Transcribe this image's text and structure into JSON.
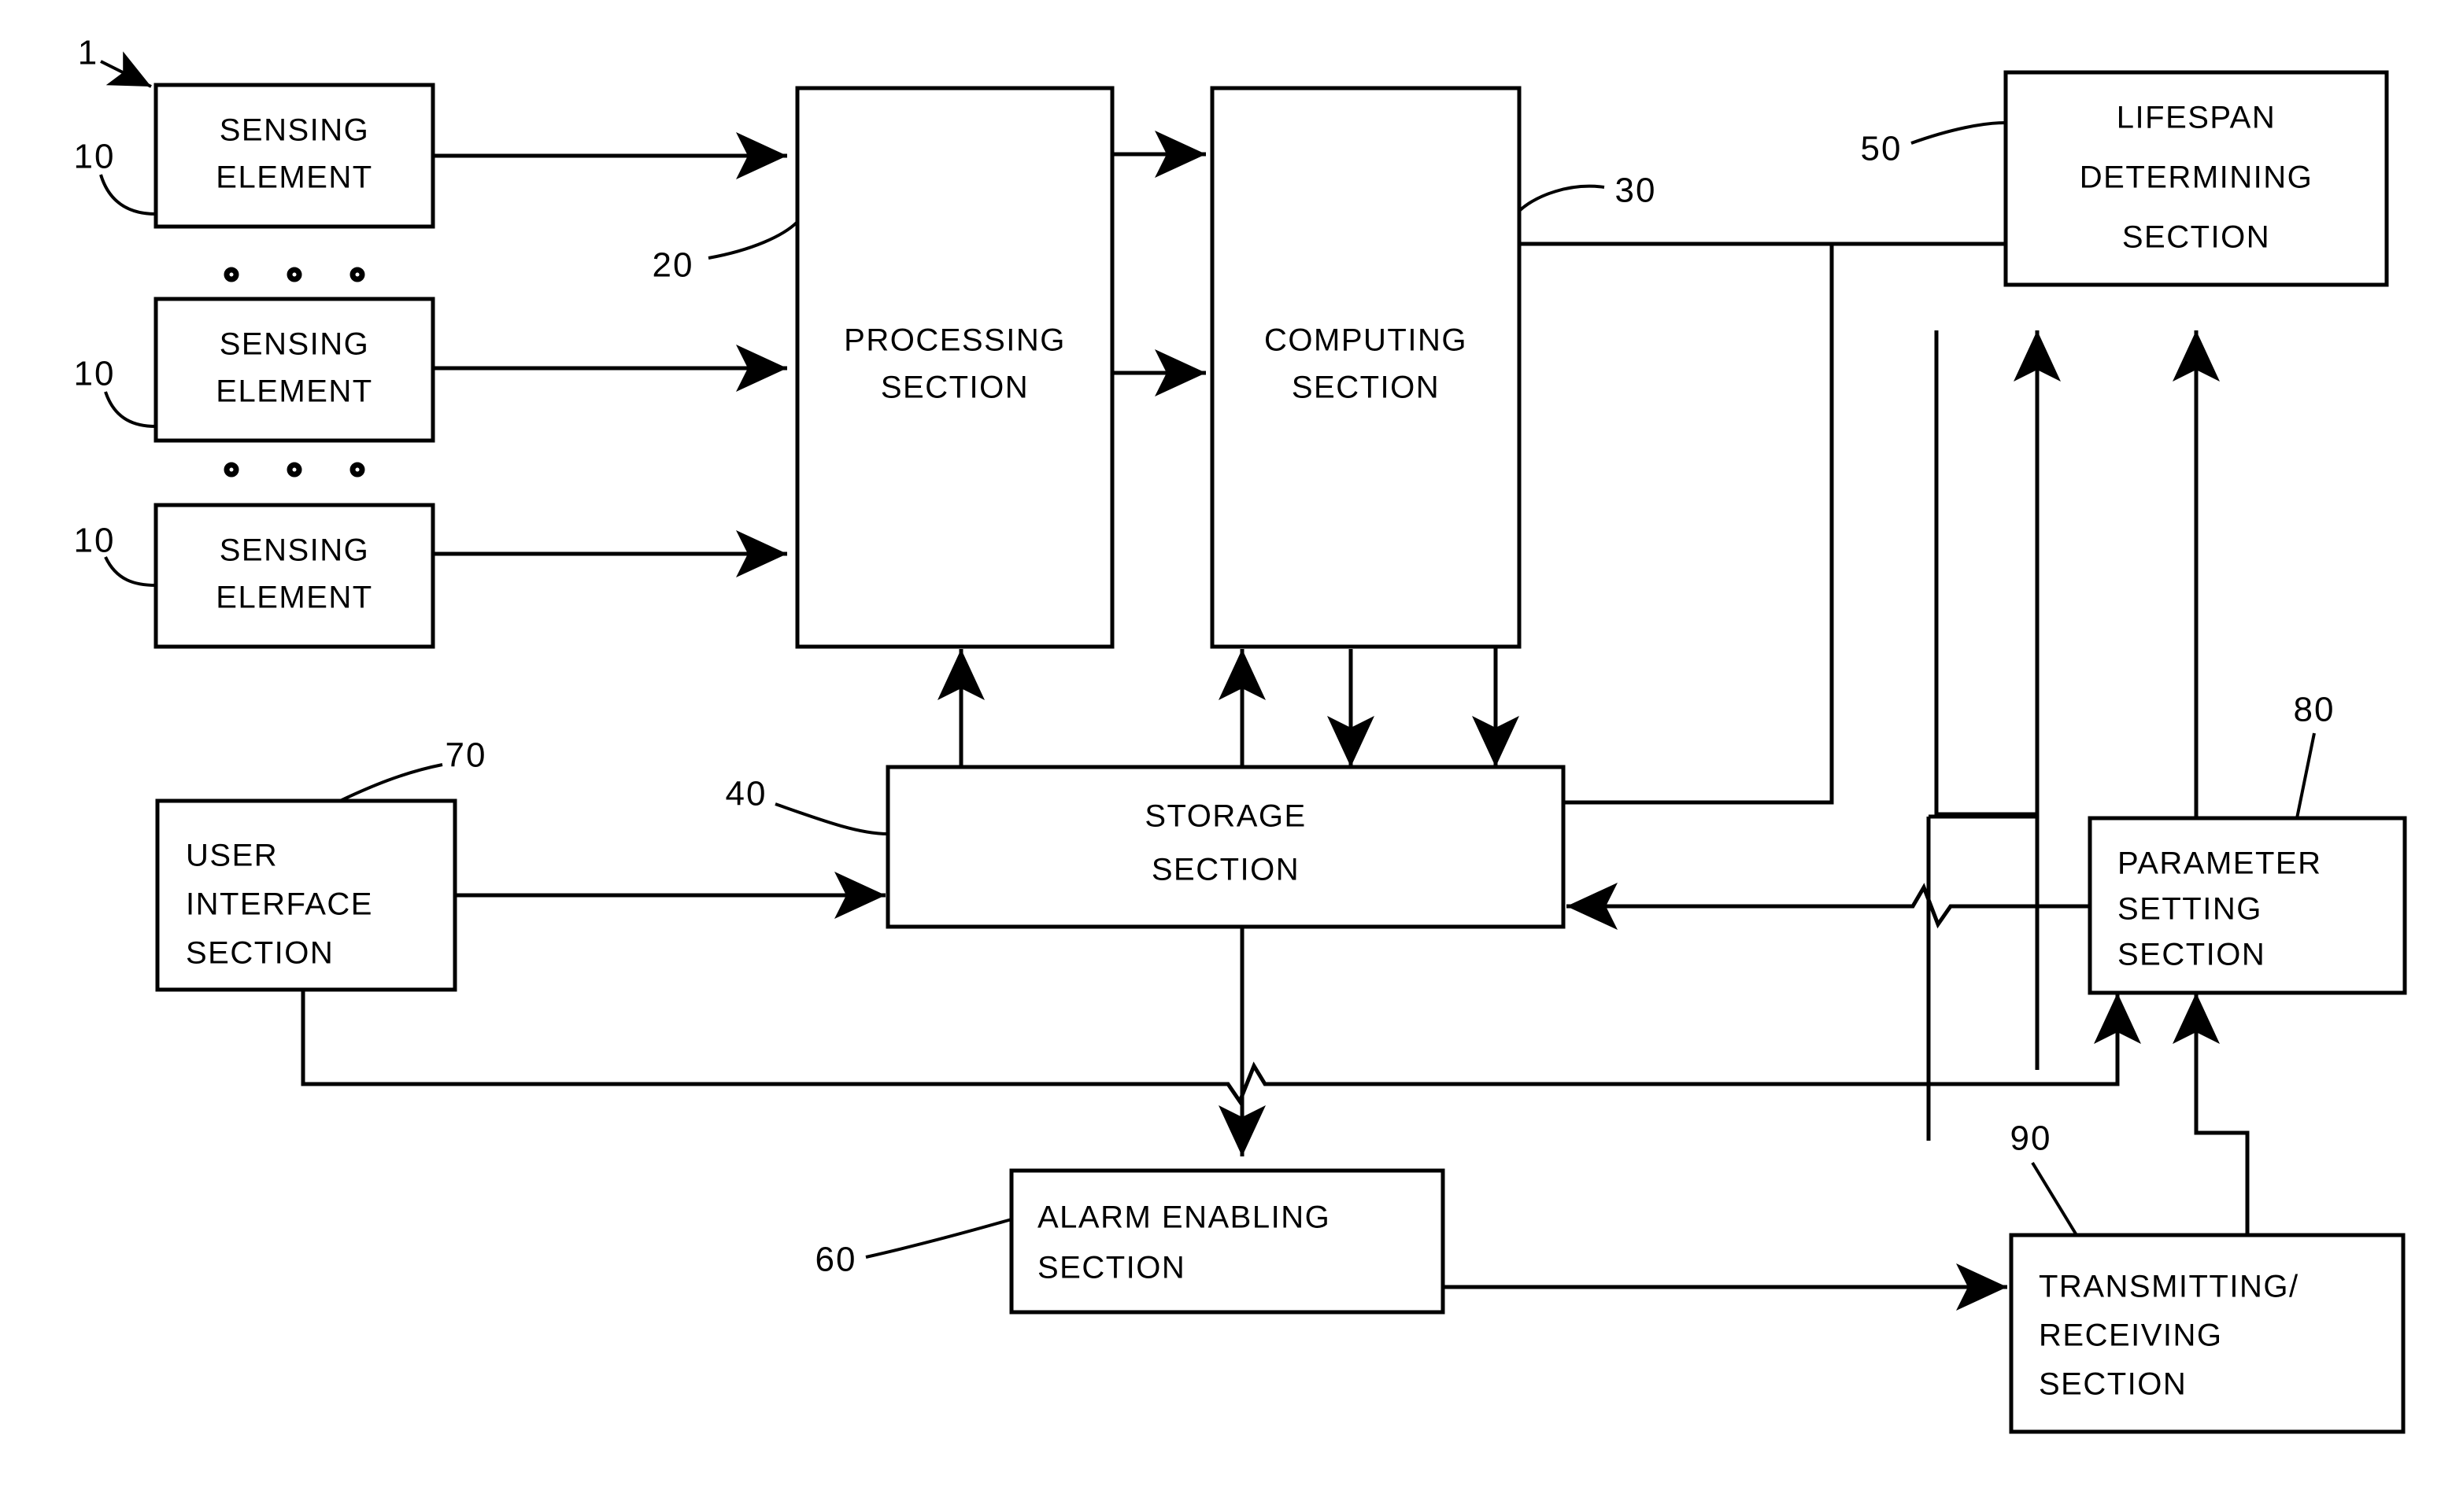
{
  "figure": {
    "type": "patent-block-diagram",
    "system_ref": "1",
    "blocks": [
      {
        "id": "sensing1",
        "ref": "10",
        "lines": [
          "SENSING",
          "ELEMENT"
        ]
      },
      {
        "id": "sensing2",
        "ref": "10",
        "lines": [
          "SENSING",
          "ELEMENT"
        ]
      },
      {
        "id": "sensing3",
        "ref": "10",
        "lines": [
          "SENSING",
          "ELEMENT"
        ]
      },
      {
        "id": "processing",
        "ref": "20",
        "lines": [
          "PROCESSING",
          "SECTION"
        ]
      },
      {
        "id": "computing",
        "ref": "30",
        "lines": [
          "COMPUTING",
          "SECTION"
        ]
      },
      {
        "id": "storage",
        "ref": "40",
        "lines": [
          "STORAGE",
          "SECTION"
        ]
      },
      {
        "id": "lifespan",
        "ref": "50",
        "lines": [
          "LIFESPAN",
          "DETERMINING",
          "SECTION"
        ]
      },
      {
        "id": "alarm",
        "ref": "60",
        "lines": [
          "ALARM ENABLING",
          "SECTION"
        ]
      },
      {
        "id": "userinterface",
        "ref": "70",
        "lines": [
          "USER",
          "INTERFACE",
          "SECTION"
        ]
      },
      {
        "id": "parameter",
        "ref": "80",
        "lines": [
          "PARAMETER",
          "SETTING",
          "SECTION"
        ]
      },
      {
        "id": "transmit",
        "ref": "90",
        "lines": [
          "TRANSMITTING/",
          "RECEIVING",
          "SECTION"
        ]
      }
    ],
    "labels": {
      "sensing_l1": "SENSING",
      "sensing_l2": "ELEMENT",
      "processing_l1": "PROCESSING",
      "processing_l2": "SECTION",
      "computing_l1": "COMPUTING",
      "computing_l2": "SECTION",
      "storage_l1": "STORAGE",
      "storage_l2": "SECTION",
      "lifespan_l1": "LIFESPAN",
      "lifespan_l2": "DETERMINING",
      "lifespan_l3": "SECTION",
      "alarm_l1": "ALARM ENABLING",
      "alarm_l2": "SECTION",
      "ui_l1": "USER",
      "ui_l2": "INTERFACE",
      "ui_l3": "SECTION",
      "param_l1": "PARAMETER",
      "param_l2": "SETTING",
      "param_l3": "SECTION",
      "transmit_l1": "TRANSMITTING/",
      "transmit_l2": "RECEIVING",
      "transmit_l3": "SECTION"
    },
    "refs": {
      "system": "1",
      "sensing1": "10",
      "sensing2": "10",
      "sensing3": "10",
      "processing": "20",
      "computing": "30",
      "storage": "40",
      "lifespan": "50",
      "alarm": "60",
      "userinterface": "70",
      "parameter": "80",
      "transmit": "90"
    },
    "colors": {
      "stroke": "#000000",
      "fill": "#ffffff"
    }
  }
}
